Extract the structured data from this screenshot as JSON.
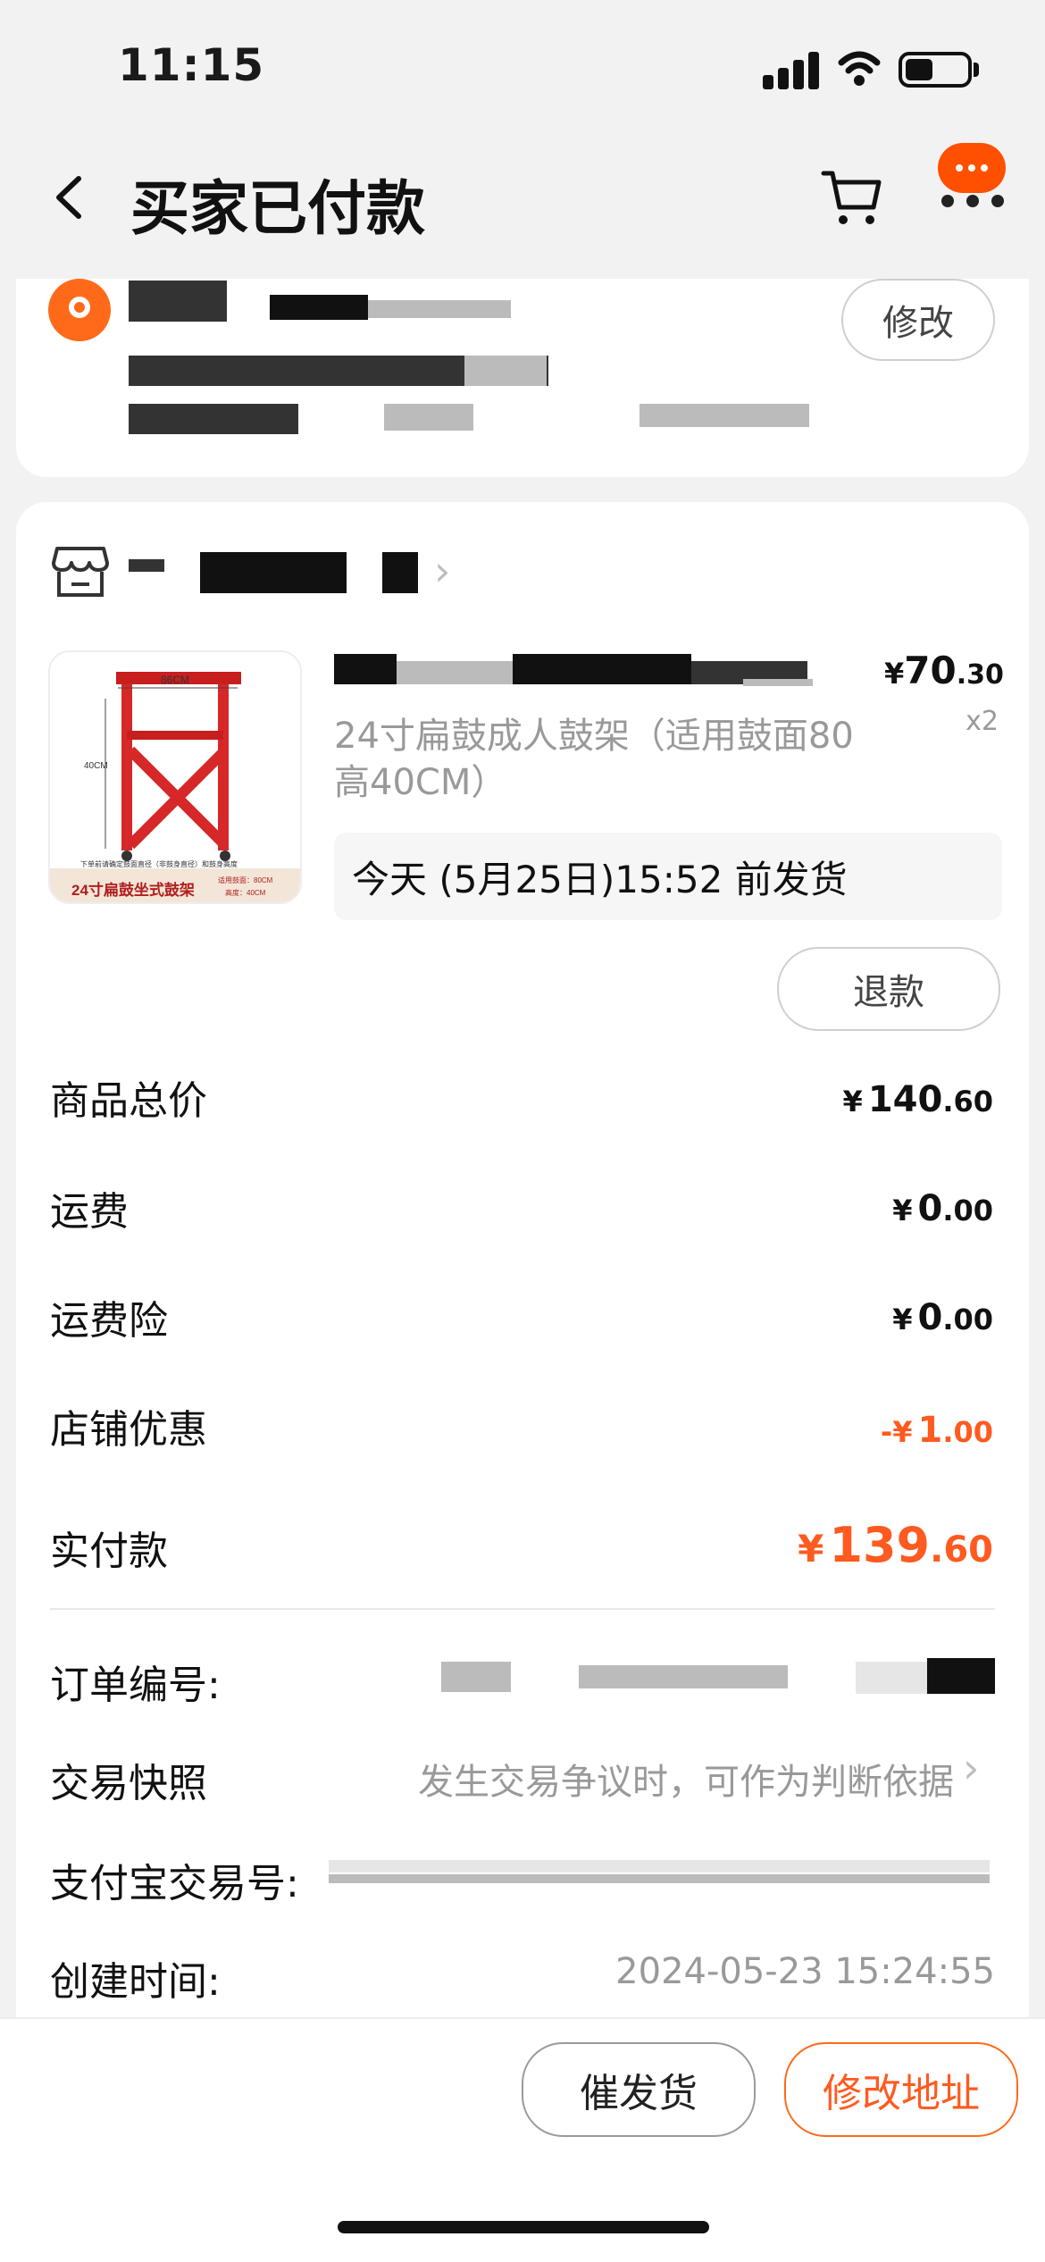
{
  "status_bar": {
    "time": "11:15"
  },
  "nav": {
    "title": "买家已付款"
  },
  "address": {
    "modify_label": "修改"
  },
  "product": {
    "name": "24寸扁鼓成人鼓架（适用鼓面80高40CM）",
    "price_yen": "¥",
    "price_int": "70",
    "price_dec": ".30",
    "quantity": "x2",
    "image_width_label": "86CM",
    "image_height_label": "40CM",
    "image_note": "下单前请确定鼓面直径（非鼓身直径）和鼓身高度",
    "image_banner": "24寸扁鼓坐式鼓架",
    "image_spec_1": "适用鼓面：80CM",
    "image_spec_2": "高度：40CM",
    "ship_text": "今天 (5月25日)15:52 前发货",
    "refund_label": "退款"
  },
  "summary": {
    "total": {
      "label": "商品总价",
      "cur": "¥",
      "int": "140",
      "dec": ".60"
    },
    "shipping": {
      "label": "运费",
      "cur": "¥",
      "int": "0",
      "dec": ".00"
    },
    "insurance": {
      "label": "运费险",
      "cur": "¥",
      "int": "0",
      "dec": ".00"
    },
    "discount": {
      "label": "店铺优惠",
      "cur": "-¥",
      "int": "1",
      "dec": ".00"
    },
    "paid": {
      "label": "实付款",
      "cur": "¥",
      "int": "139",
      "dec": ".60"
    }
  },
  "info": {
    "order_no_label": "订单编号:",
    "snapshot_label": "交易快照",
    "snapshot_value": "发生交易争议时，可作为判断依据",
    "alipay_label": "支付宝交易号:",
    "created_label": "创建时间:",
    "created_value": "2024-05-23 15:24:55"
  },
  "actions": {
    "urge_label": "催发货",
    "modify_address_label": "修改地址"
  },
  "colors": {
    "accent": "#ff5000",
    "price_orange": "#ff5a1f",
    "muted": "#999999"
  }
}
